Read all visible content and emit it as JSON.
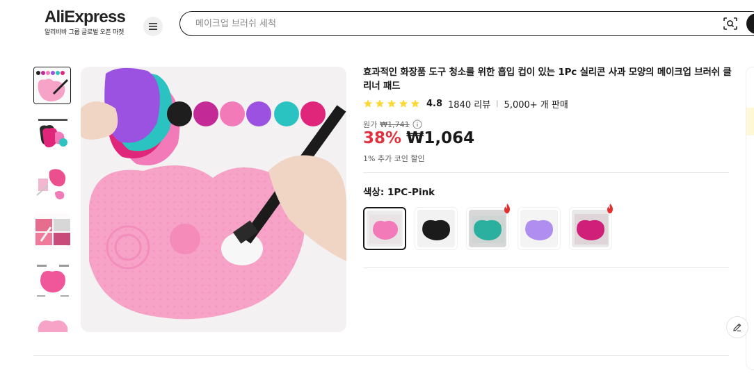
{
  "header": {
    "logo_text": "AliExpress",
    "logo_sub": "알리바바 그룹 글로벌 오픈 마켓",
    "search_placeholder": "메이크업 브러쉬 세척",
    "search_value": ""
  },
  "gallery": {
    "thumbnails": [
      "thumb-1",
      "thumb-2",
      "thumb-3",
      "thumb-4",
      "thumb-5",
      "thumb-6"
    ],
    "active_index": 0
  },
  "product": {
    "title": "효과적인 화장품 도구 청소를 위한 흡입 컵이 있는 1Pc 실리콘 사과 모양의 메이크업 브러쉬 클리너 패드",
    "rating": "4.8",
    "reviews": "1840 리뷰",
    "sold": "5,000+ 개 판매",
    "original_label": "원가",
    "original_price": "₩1,741",
    "discount": "38%",
    "price": "₩1,064",
    "coin_note": "1% 추가 코인 할인",
    "color_label": "색상: 1PC-Pink",
    "colors": [
      {
        "name": "1PC-Pink",
        "hex": "#f27ab8",
        "hot": false
      },
      {
        "name": "Black",
        "hex": "#1b1b1b",
        "hot": false
      },
      {
        "name": "Green",
        "hex": "#2bb0a0",
        "hot": true
      },
      {
        "name": "Purple",
        "hex": "#b08ef0",
        "hot": false
      },
      {
        "name": "Rose",
        "hex": "#cf1f79",
        "hot": true
      }
    ]
  },
  "colors": {
    "accent_red": "#e0313f",
    "text": "#191919"
  }
}
